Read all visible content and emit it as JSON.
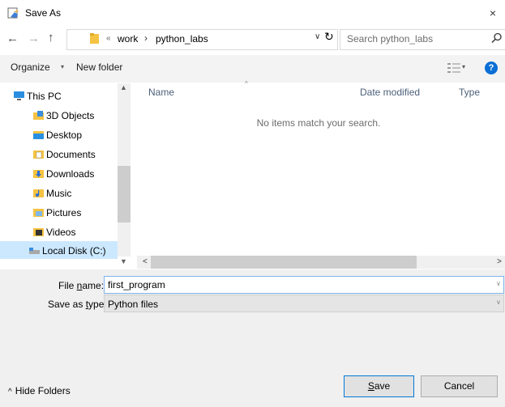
{
  "window": {
    "title": "Save As",
    "close": "×"
  },
  "nav_buttons": {
    "back": "←",
    "forward": "→",
    "up": "↑",
    "refresh": "↻"
  },
  "address": {
    "separator_root": "«",
    "crumb_1": "work",
    "separator": "›",
    "crumb_2": "python_labs",
    "dropdown": "∨"
  },
  "search": {
    "placeholder": "Search python_labs"
  },
  "toolbar": {
    "organize": "Organize",
    "caret": "▾",
    "new_folder": "New folder",
    "help": "?"
  },
  "sidebar": {
    "items": [
      {
        "label": "This PC",
        "icon": "pc-icon"
      },
      {
        "label": "3D Objects",
        "icon": "3d-objects-icon"
      },
      {
        "label": "Desktop",
        "icon": "desktop-icon"
      },
      {
        "label": "Documents",
        "icon": "documents-icon"
      },
      {
        "label": "Downloads",
        "icon": "downloads-icon"
      },
      {
        "label": "Music",
        "icon": "music-icon"
      },
      {
        "label": "Pictures",
        "icon": "pictures-icon"
      },
      {
        "label": "Videos",
        "icon": "videos-icon"
      },
      {
        "label": "Local Disk (C:)",
        "icon": "local-disk-icon"
      }
    ],
    "scroll_up": "▲",
    "scroll_down": "▼"
  },
  "columns": {
    "name": "Name",
    "sort_indicator": "^",
    "date_modified": "Date modified",
    "type": "Type"
  },
  "content": {
    "empty_message": "No items match your search."
  },
  "hscroll": {
    "left": "<",
    "right": ">"
  },
  "form": {
    "filename_label_pre": "File ",
    "filename_label_accel": "n",
    "filename_label_post": "ame:",
    "filename_value": "first_program",
    "savetype_label_pre": "Save as ",
    "savetype_label_accel": "t",
    "savetype_label_post": "ype:",
    "savetype_value": "Python files",
    "dropdown_caret": "∨"
  },
  "footer": {
    "hide_folders": "Hide Folders",
    "hide_caret": "^",
    "save_accel": "S",
    "save_rest": "ave",
    "cancel": "Cancel"
  },
  "colors": {
    "accent": "#0078d7",
    "selection": "#cce8ff",
    "help": "#0b6fd6"
  }
}
